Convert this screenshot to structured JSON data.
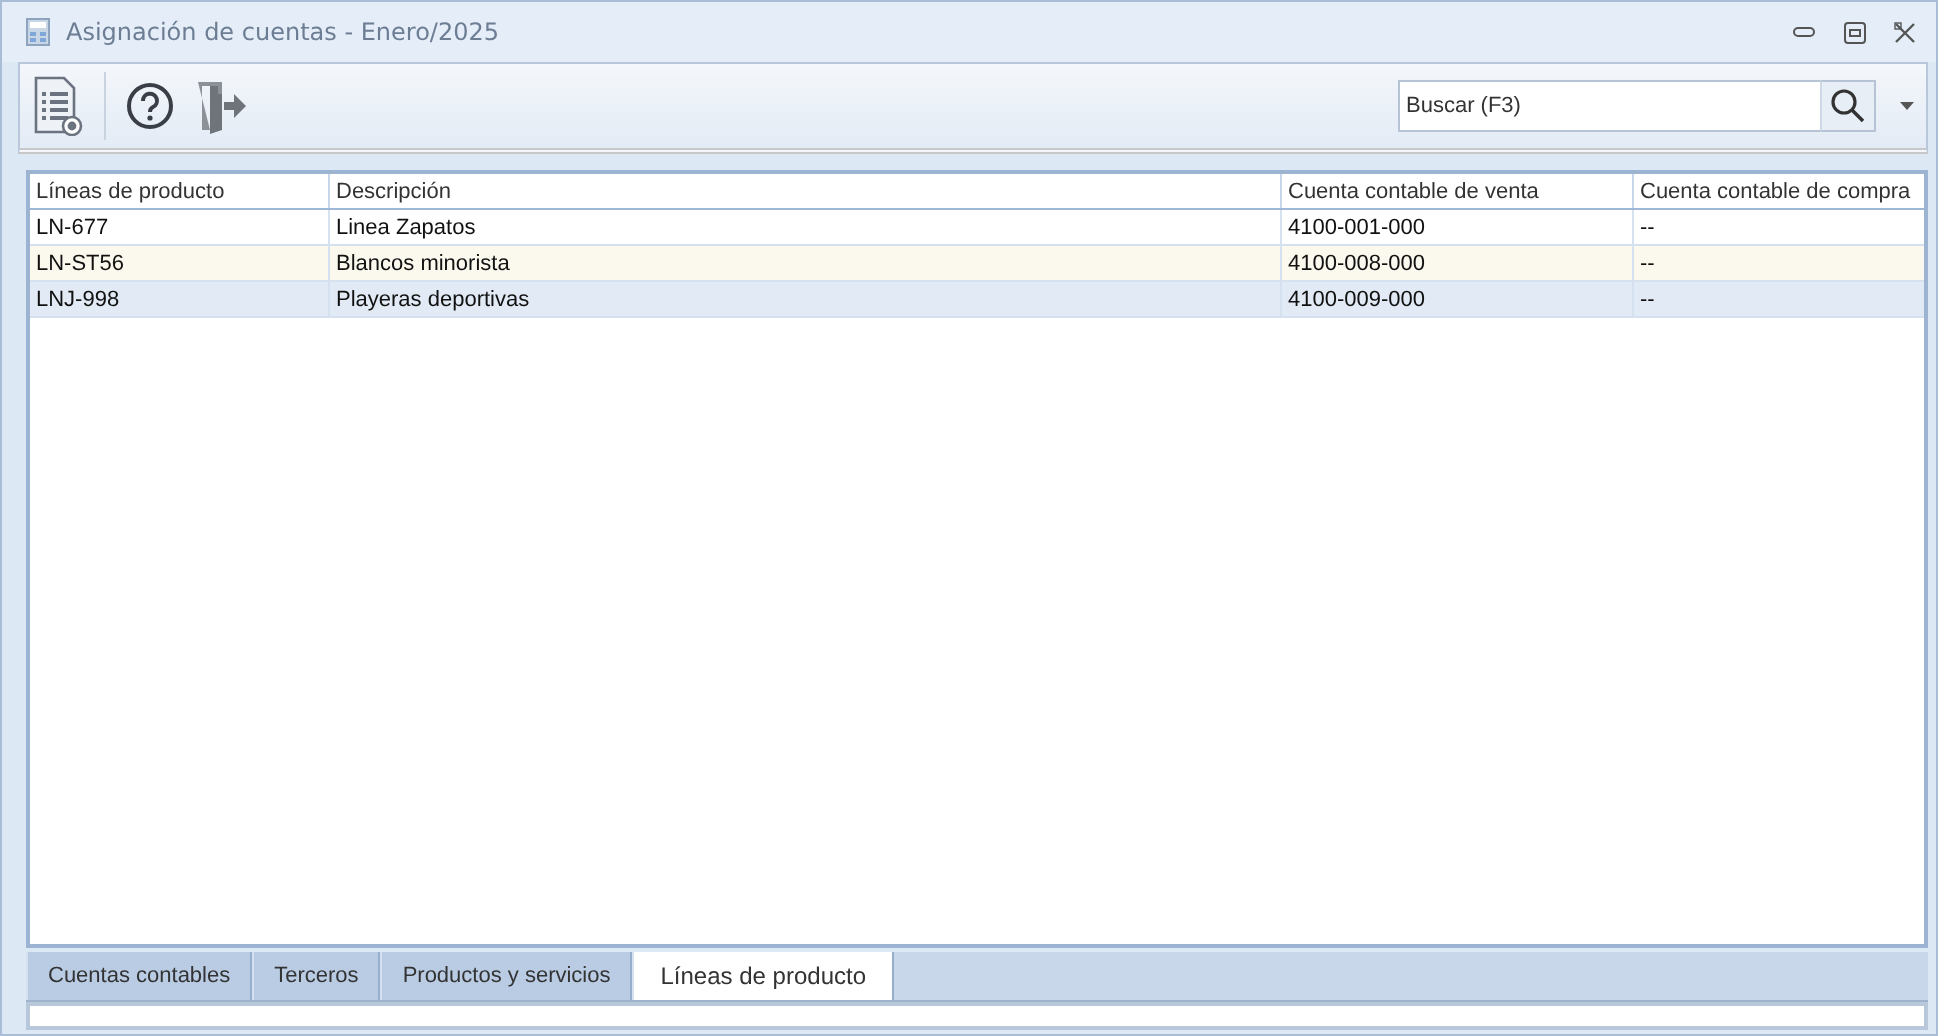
{
  "window": {
    "title": "Asignación de cuentas - Enero/2025"
  },
  "search": {
    "placeholder": "Buscar (F3)"
  },
  "table": {
    "columns": [
      "Líneas de producto",
      "Descripción",
      "Cuenta contable de venta",
      "Cuenta contable de compra"
    ],
    "rows": [
      {
        "cells": [
          "LN-677",
          "Linea Zapatos",
          "4100-001-000",
          "--"
        ],
        "selected": false
      },
      {
        "cells": [
          "LN-ST56",
          "Blancos minorista",
          "4100-008-000",
          "--"
        ],
        "selected": false
      },
      {
        "cells": [
          "LNJ-998",
          "Playeras deportivas",
          "4100-009-000",
          "--"
        ],
        "selected": true
      }
    ]
  },
  "tabs": [
    {
      "label": "Cuentas contables",
      "selected": false
    },
    {
      "label": "Terceros",
      "selected": false
    },
    {
      "label": "Productos y servicios",
      "selected": false
    },
    {
      "label": "Líneas de producto",
      "selected": true
    }
  ]
}
